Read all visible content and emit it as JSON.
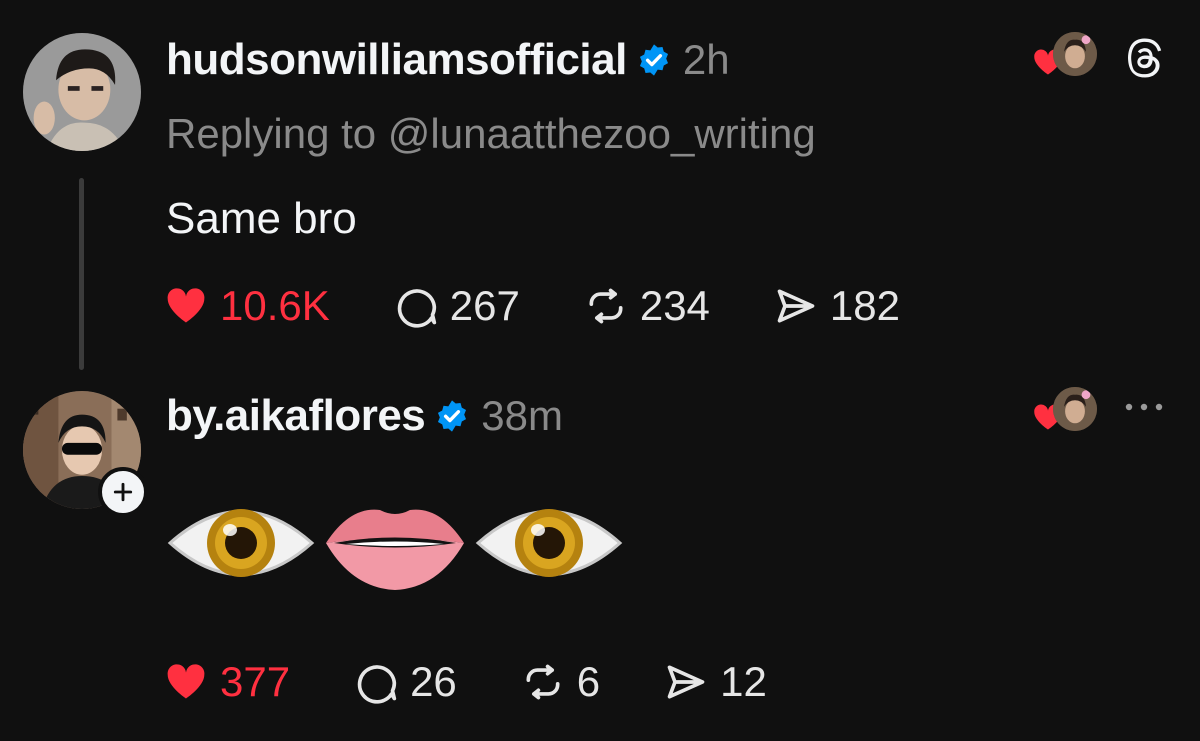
{
  "posts": [
    {
      "username": "hudsonwilliamsofficial",
      "time": "2h",
      "replying_to": "Replying to @lunaatthezoo_writing",
      "text": "Same bro",
      "likes": "10.6K",
      "replies": "267",
      "reposts": "234",
      "shares": "182"
    },
    {
      "username": "by.aikaflores",
      "time": "38m",
      "emojis": [
        "eye",
        "lips",
        "eye"
      ],
      "likes": "377",
      "replies": "26",
      "reposts": "6",
      "shares": "12"
    }
  ],
  "icons": {
    "app": "threads-logo-icon",
    "more": "more-options-icon",
    "verified": "verified-badge-icon",
    "like": "heart-icon",
    "reply": "comment-bubble-icon",
    "repost": "repost-icon",
    "share": "send-icon",
    "follow": "plus-icon"
  },
  "colors": {
    "background": "#101010",
    "like_red": "#ff3040",
    "verified_blue": "#0095f6",
    "muted": "#8a8a8a"
  }
}
